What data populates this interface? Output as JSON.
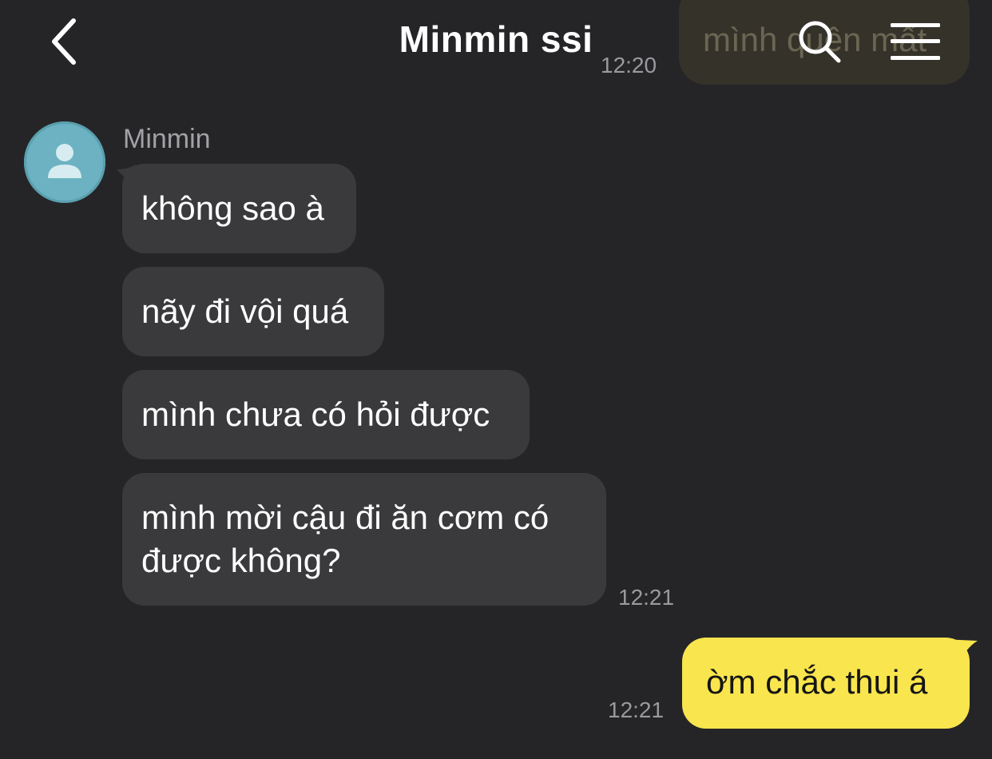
{
  "header": {
    "title": "Minmin ssi",
    "back_icon": "chevron-left-icon",
    "search_icon": "search-icon",
    "menu_icon": "hamburger-menu-icon"
  },
  "previous_message": {
    "text": "mình quên mất",
    "time": "12:20"
  },
  "conversation": {
    "sender": {
      "name": "Minmin",
      "avatar_icon": "person-icon",
      "avatar_color": "#6cb2c2"
    },
    "incoming": [
      {
        "text": "không sao à"
      },
      {
        "text": "nãy đi vội quá"
      },
      {
        "text": "mình chưa có hỏi được"
      },
      {
        "text_line1": "mình mời cậu đi ăn cơm có",
        "text_line2": "được không?"
      }
    ],
    "incoming_time": "12:21",
    "outgoing": [
      {
        "text": "ờm chắc thui á"
      }
    ],
    "outgoing_time": "12:21"
  },
  "colors": {
    "background": "#252528",
    "incoming_bubble": "#3a3a3c",
    "outgoing_bubble": "#f9e54d",
    "timestamp": "#9a9a9e"
  }
}
